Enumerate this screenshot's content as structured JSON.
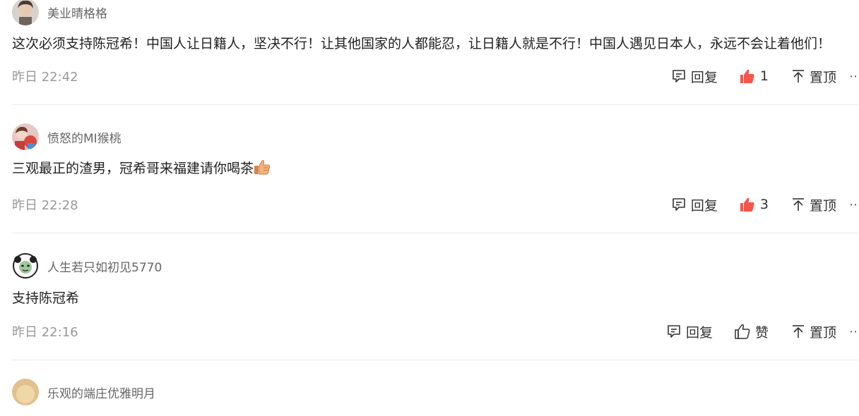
{
  "comments": [
    {
      "username": "美业晴格格",
      "text": "这次必须支持陈冠希！中国人让日籍人，坚决不行！让其他国家的人都能忍，让日籍人就是不行！中国人遇见日本人，永远不会让着他们！",
      "time": "昨日 22:42",
      "reply_label": "回复",
      "like_count": "1",
      "pin_label": "置顶",
      "liked": true
    },
    {
      "username": "愤怒的MI猴桃",
      "text": "三观最正的渣男，冠希哥来福建请你喝茶",
      "time": "昨日 22:28",
      "reply_label": "回复",
      "like_count": "3",
      "pin_label": "置顶",
      "liked": true
    },
    {
      "username": "人生若只如初见5770",
      "text": "支持陈冠希",
      "time": "昨日 22:16",
      "reply_label": "回复",
      "like_label": "赞",
      "pin_label": "置顶",
      "liked": false
    },
    {
      "username": "乐观的端庄优雅明月"
    }
  ],
  "colors": {
    "liked": "#f4564d",
    "muted": "#999999",
    "divider": "#ececec"
  },
  "icons": {
    "reply": "reply-icon",
    "like": "thumbs-up-icon",
    "pin": "pin-top-icon",
    "more": "more-icon"
  }
}
